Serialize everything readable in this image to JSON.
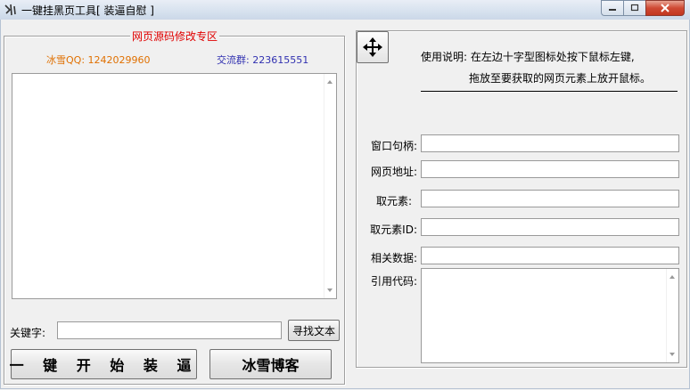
{
  "window": {
    "title": "一键挂黑页工具[ 装逼自慰 ]",
    "icons": [
      "app-icon",
      "minimize-icon",
      "maximize-icon",
      "close-icon"
    ]
  },
  "left": {
    "group_title": "网页源码修改专区",
    "qq": "冰雪QQ: 1242029960",
    "group_number": "交流群: 223615551",
    "keyword_label": "关键字:",
    "keyword_value": "",
    "find_button": "寻找文本",
    "start_button": "一 键 开 始 装 逼",
    "blog_button": "冰雪博客"
  },
  "right": {
    "usage_line1": "使用说明: 在左边十字型图标处按下鼠标左键,",
    "usage_line2": "拖放至要获取的网页元素上放开鼠标。",
    "fields": {
      "window_handle": "窗口句柄:",
      "url": "网页地址:",
      "element": "取元素:",
      "element_id": "取元素ID:",
      "related_data": "相关数据:",
      "reference_code": "引用代码:"
    }
  },
  "colors": {
    "group_title": "#e00000",
    "qq": "#e07000",
    "group_number": "#3030b0"
  }
}
